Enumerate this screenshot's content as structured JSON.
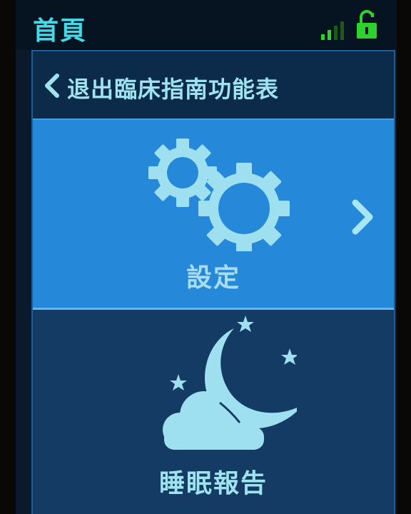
{
  "status_bar": {
    "title": "首頁",
    "signal_icon": "signal-bars-icon",
    "lock_icon": "unlocked-padlock-icon"
  },
  "header": {
    "back_label": "退出臨床指南功能表",
    "back_icon": "chevron-left-icon"
  },
  "menu": {
    "items": [
      {
        "label": "設定",
        "icon": "gears-icon",
        "has_chevron": true
      },
      {
        "label": "睡眠報告",
        "icon": "moon-cloud-stars-icon",
        "has_chevron": false
      }
    ]
  },
  "colors": {
    "accent": "#45d8e6",
    "signal": "#2ed12e",
    "selected_tile": "#2688d8",
    "tile": "#133b64",
    "header_bg": "#0c2a4a"
  }
}
